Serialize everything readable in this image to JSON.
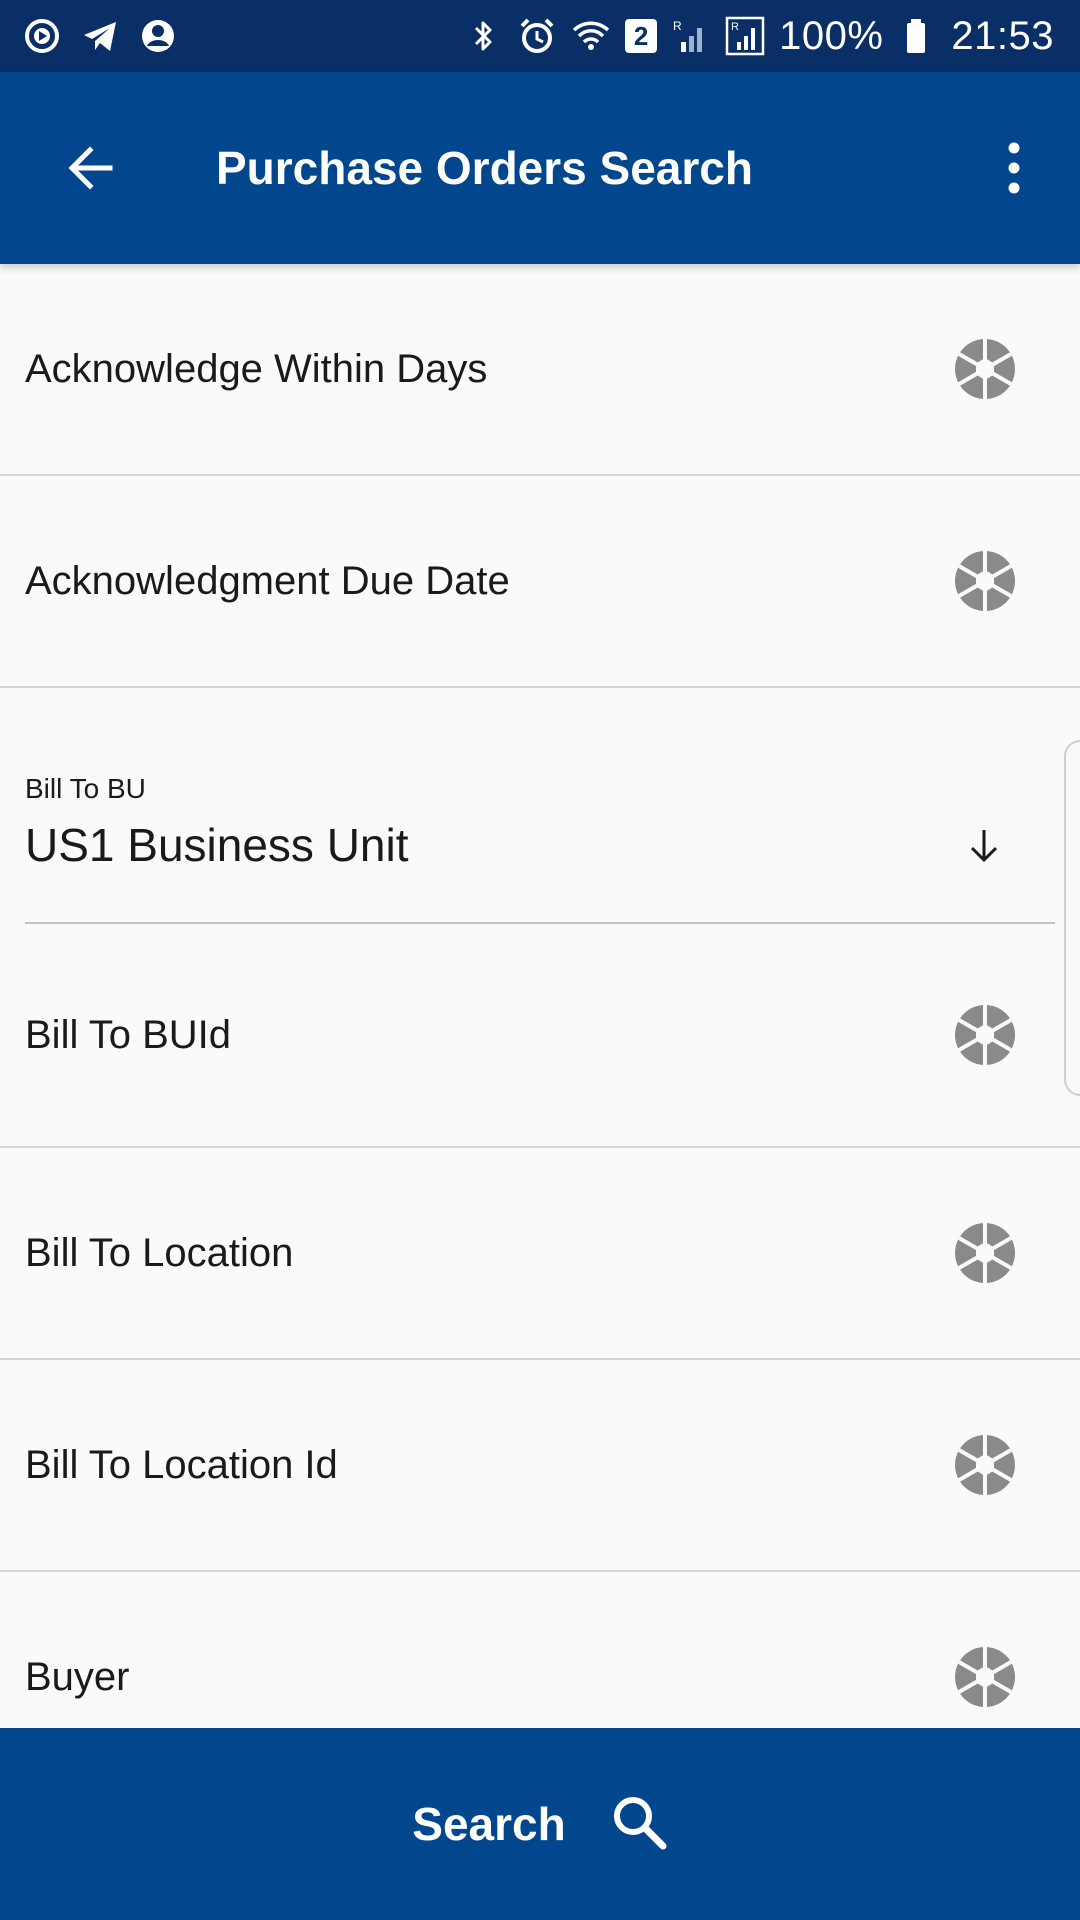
{
  "status_bar": {
    "battery": "100%",
    "time": "21:53",
    "notification_count": "2",
    "icons_left": [
      "play-circle-icon",
      "telegram-icon",
      "account-circle-icon"
    ],
    "icons_right": [
      "bluetooth-icon",
      "alarm-icon",
      "wifi-icon",
      "sim-badge-icon",
      "signal-roaming-icon",
      "signal-roaming-icon",
      "battery-icon"
    ]
  },
  "app_bar": {
    "title": "Purchase Orders Search",
    "back_icon": "arrow-left-icon",
    "menu_icon": "more-vertical-icon"
  },
  "fields": {
    "acknowledge_within_days": "Acknowledge Within Days",
    "acknowledgment_due_date": "Acknowledgment Due Date",
    "bill_to_bu": {
      "caption": "Bill To BU",
      "value": "US1 Business Unit"
    },
    "bill_to_buid": "Bill To BUId",
    "bill_to_location": "Bill To Location",
    "bill_to_location_id": "Bill To Location Id",
    "buyer": "Buyer",
    "row_icon": "aperture-icon"
  },
  "footer": {
    "search_label": "Search",
    "search_icon": "search-icon"
  },
  "colors": {
    "status_bar": "#0a2f66",
    "app_bar": "#02468d",
    "background": "#fafafa",
    "icon_gray": "#8a8a8a",
    "divider": "#d6d6d6"
  }
}
